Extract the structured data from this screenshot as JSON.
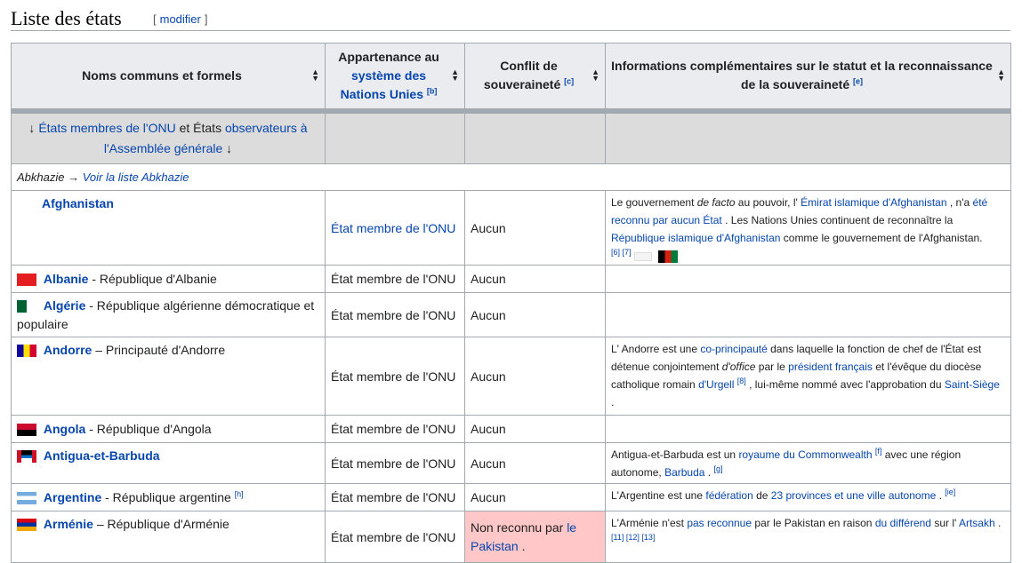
{
  "section": {
    "title": "Liste des états",
    "edit_label": "modifier",
    "bracket_open": "[",
    "bracket_close": "]"
  },
  "table": {
    "headers": {
      "col1": "Noms communs et formels",
      "col2_a": "Appartenance au",
      "col2_link": "système des Nations Unies",
      "col2_ref": "[b]",
      "col3": "Conflit de souveraineté",
      "col3_ref": "[c]",
      "col4": "Informations complémentaires sur le statut et la reconnaissance de la souveraineté",
      "col4_ref": "[e]"
    },
    "group_row": {
      "arrow_down": "↓",
      "link1": "États membres de l'ONU",
      "mid": "et États",
      "link2": "observateurs à l'Assemblée générale"
    },
    "abkhazie": {
      "name": "Abkhazie",
      "arrow": "→",
      "link": "Voir la liste Abkhazie"
    },
    "rows": [
      {
        "name": "Afghanistan",
        "formal": "",
        "flag_colors": [
          "#ffffff"
        ],
        "membership": "État membre de l'ONU",
        "membership_link": true,
        "conflict": "Aucun",
        "info": {
          "t1": "Le gouvernement",
          "i1": "de facto",
          "t2": "au pouvoir, l'",
          "l1": "Émirat islamique d'Afghanistan",
          "t3": ", n'a",
          "l2": "été reconnu par aucun État",
          "t4": ". Les Nations Unies continuent de reconnaître la",
          "l3": "République islamique d'Afghanistan",
          "t5": "comme le gouvernement de l'Afghanistan.",
          "refs": "[6] [7]"
        }
      },
      {
        "name": "Albanie",
        "formal": "- République d'Albanie",
        "membership": "État membre de l'ONU",
        "conflict": "Aucun"
      },
      {
        "name": "Algérie",
        "formal": "- République algérienne démocratique et populaire",
        "membership": "État membre de l'ONU",
        "conflict": "Aucun"
      },
      {
        "name": "Andorre",
        "formal": "– Principauté d'Andorre",
        "membership": "État membre de l'ONU",
        "conflict": "Aucun",
        "info": {
          "t1": "L' Andorre est une",
          "l1": "co-principauté",
          "t2": "dans laquelle la fonction de chef de l'État est détenue conjointement",
          "i1": "d'office",
          "t3": "par le",
          "l2": "président français",
          "t4": "et l'évêque du diocèse catholique romain",
          "l3": "d'Urgell",
          "ref1": "[8]",
          "t5": ", lui-même nommé avec l'approbation du",
          "l4": "Saint-Siège",
          "t6": "."
        }
      },
      {
        "name": "Angola",
        "formal": "- République d'Angola",
        "membership": "État membre de l'ONU",
        "conflict": "Aucun"
      },
      {
        "name": "Antigua-et-Barbuda",
        "formal": "",
        "membership": "État membre de l'ONU",
        "conflict": "Aucun",
        "info": {
          "t1": "Antigua-et-Barbuda est un",
          "l1": "royaume du Commonwealth",
          "ref1": "[f]",
          "t2": "avec une région autonome,",
          "l2": "Barbuda",
          "t3": ".",
          "ref2": "[g]"
        }
      },
      {
        "name": "Argentine",
        "formal": "- République argentine",
        "formal_ref": "[h]",
        "membership": "État membre de l'ONU",
        "conflict": "Aucun",
        "info": {
          "t1": "L'Argentine est une",
          "l1": "fédération",
          "t2": "de",
          "l2": "23 provinces et une ville autonome",
          "t3": ".",
          "ref1": "[ie]"
        }
      },
      {
        "name": "Arménie",
        "formal": "– République d'Arménie",
        "membership": "État membre de l'ONU",
        "conflict_pre": "Non reconnu par",
        "conflict_link": "le Pakistan",
        "conflict_post": ".",
        "info": {
          "t1": "L'Arménie n'est",
          "l1": "pas reconnue",
          "t2": "par le Pakistan en raison",
          "l2": "du différend",
          "t3": "sur l'",
          "l3": "Artsakh",
          "t4": ".",
          "refs": "[11] [12] [13]"
        }
      }
    ]
  },
  "colors": {
    "link": "#0645ad",
    "header_bg": "#eaecf0",
    "group_bg": "#dcdcdc",
    "conflict_bg": "#ffc7c7",
    "border": "#a2a9b1"
  }
}
